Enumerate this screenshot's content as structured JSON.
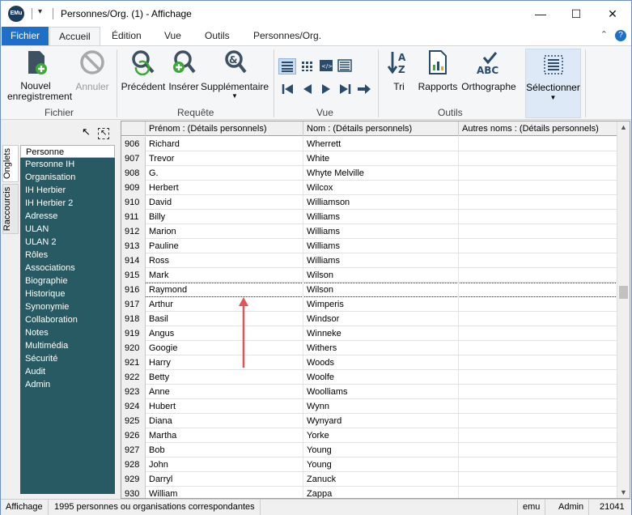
{
  "window": {
    "title": "Personnes/Org. (1) - Affichage",
    "app_badge": "EMu",
    "controls": {
      "minimize": "—",
      "maximize": "☐",
      "close": "✕"
    }
  },
  "tabs": [
    {
      "label": "Fichier"
    },
    {
      "label": "Accueil"
    },
    {
      "label": "Édition"
    },
    {
      "label": "Vue"
    },
    {
      "label": "Outils"
    },
    {
      "label": "Personnes/Org."
    }
  ],
  "ribbon": {
    "fichier": {
      "group": "Fichier",
      "new_record": "Nouvel enregistrement",
      "cancel": "Annuler"
    },
    "requete": {
      "group": "Requête",
      "previous": "Précédent",
      "insert": "Insérer",
      "additional": "Supplémentaire"
    },
    "vue": {
      "group": "Vue"
    },
    "outils": {
      "group": "Outils",
      "sort": "Tri",
      "reports": "Rapports",
      "spelling": "Orthographe",
      "select": "Sélectionner"
    }
  },
  "side_tabs": {
    "tabs": "Onglets",
    "shortcuts": "Raccourcis"
  },
  "nav_items": [
    "Personne",
    "Personne IH",
    "Organisation",
    "IH Herbier",
    "IH Herbier 2",
    "Adresse",
    "ULAN",
    "ULAN 2",
    "Rôles",
    "Associations",
    "Biographie",
    "Historique",
    "Synonymie",
    "Collaboration",
    "Notes",
    "Multimédia",
    "Sécurité",
    "Audit",
    "Admin"
  ],
  "grid": {
    "columns": [
      "Prénom : (Détails personnels)",
      "Nom : (Détails personnels)",
      "Autres noms : (Détails personnels)"
    ],
    "rows": [
      [
        "906",
        "Richard",
        "Wherrett",
        ""
      ],
      [
        "907",
        "Trevor",
        "White",
        ""
      ],
      [
        "908",
        "G.",
        "Whyte Melville",
        ""
      ],
      [
        "909",
        "Herbert",
        "Wilcox",
        ""
      ],
      [
        "910",
        "David",
        "Williamson",
        ""
      ],
      [
        "911",
        "Billy",
        "Williams",
        ""
      ],
      [
        "912",
        "Marion",
        "Williams",
        ""
      ],
      [
        "913",
        "Pauline",
        "Williams",
        ""
      ],
      [
        "914",
        "Ross",
        "Williams",
        ""
      ],
      [
        "915",
        "Mark",
        "Wilson",
        ""
      ],
      [
        "916",
        "Raymond",
        "Wilson",
        ""
      ],
      [
        "917",
        "Arthur",
        "Wimperis",
        ""
      ],
      [
        "918",
        "Basil",
        "Windsor",
        ""
      ],
      [
        "919",
        "Angus",
        "Winneke",
        ""
      ],
      [
        "920",
        "Googie",
        "Withers",
        ""
      ],
      [
        "921",
        "Harry",
        "Woods",
        ""
      ],
      [
        "922",
        "Betty",
        "Woolfe",
        ""
      ],
      [
        "923",
        "Anne",
        "Woolliams",
        ""
      ],
      [
        "924",
        "Hubert",
        "Wynn",
        ""
      ],
      [
        "925",
        "Diana",
        "Wynyard",
        ""
      ],
      [
        "926",
        "Martha",
        "Yorke",
        ""
      ],
      [
        "927",
        "Bob",
        "Young",
        ""
      ],
      [
        "928",
        "John",
        "Young",
        ""
      ],
      [
        "929",
        "Darryl",
        "Zanuck",
        ""
      ],
      [
        "930",
        "William",
        "Zappa",
        ""
      ]
    ],
    "current_row": "916"
  },
  "status": {
    "mode": "Affichage",
    "message": "1995 personnes ou organisations correspondantes",
    "user": "emu",
    "role": "Admin",
    "count": "21041"
  },
  "colors": {
    "file_tab": "#1e6fc8",
    "nav_bg": "#275a63",
    "annotation_arrow": "#e05555"
  }
}
